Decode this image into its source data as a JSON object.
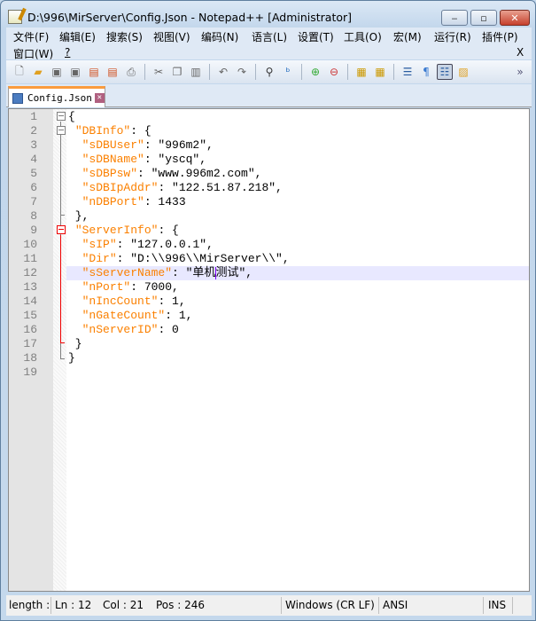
{
  "window": {
    "title": "D:\\996\\MirServer\\Config.Json - Notepad++ [Administrator]",
    "minimize": "‒",
    "maximize": "▫",
    "close": "✕"
  },
  "menu": {
    "items": [
      "文件(F)",
      "编辑(E)",
      "搜索(S)",
      "视图(V)",
      "编码(N)",
      "语言(L)",
      "设置(T)",
      "工具(O)",
      "宏(M)",
      "运行(R)",
      "插件(P)",
      "窗口(W)",
      "?"
    ],
    "close_doc": "X"
  },
  "toolbar": {
    "icons": [
      "new-file-icon",
      "open-file-icon",
      "save-icon",
      "save-all-icon",
      "close-icon",
      "close-all-icon",
      "print-icon",
      "cut-icon",
      "copy-icon",
      "paste-icon",
      "undo-icon",
      "redo-icon",
      "find-icon",
      "replace-icon",
      "zoom-in-icon",
      "zoom-out-icon",
      "sync-vertical-icon",
      "sync-horizontal-icon",
      "word-wrap-icon",
      "show-all-chars-icon",
      "indent-guide-icon",
      "user-language-icon"
    ],
    "overflow": "»"
  },
  "tab": {
    "label": "Config.Json",
    "close": "✕"
  },
  "editor": {
    "current_line": 12,
    "lines": [
      [
        [
          "p",
          "{"
        ]
      ],
      [
        [
          "p",
          " "
        ],
        [
          "k",
          "\"DBInfo\""
        ],
        [
          "p",
          ": {"
        ]
      ],
      [
        [
          "p",
          "  "
        ],
        [
          "k",
          "\"sDBUser\""
        ],
        [
          "p",
          ": \"996m2\","
        ]
      ],
      [
        [
          "p",
          "  "
        ],
        [
          "k",
          "\"sDBName\""
        ],
        [
          "p",
          ": \"yscq\","
        ]
      ],
      [
        [
          "p",
          "  "
        ],
        [
          "k",
          "\"sDBPsw\""
        ],
        [
          "p",
          ": \"www.996m2.com\","
        ]
      ],
      [
        [
          "p",
          "  "
        ],
        [
          "k",
          "\"sDBIpAddr\""
        ],
        [
          "p",
          ": \"122.51.87.218\","
        ]
      ],
      [
        [
          "p",
          "  "
        ],
        [
          "k",
          "\"nDBPort\""
        ],
        [
          "p",
          ": 1433"
        ]
      ],
      [
        [
          "p",
          " },"
        ]
      ],
      [
        [
          "p",
          " "
        ],
        [
          "k",
          "\"ServerInfo\""
        ],
        [
          "p",
          ": {"
        ]
      ],
      [
        [
          "p",
          "  "
        ],
        [
          "k",
          "\"sIP\""
        ],
        [
          "p",
          ": \"127.0.0.1\","
        ]
      ],
      [
        [
          "p",
          "  "
        ],
        [
          "k",
          "\"Dir\""
        ],
        [
          "p",
          ": \"D:\\\\996\\\\MirServer\\\\\","
        ]
      ],
      [
        [
          "p",
          "  "
        ],
        [
          "k",
          "\"sServerName\""
        ],
        [
          "p",
          ": \"单机"
        ],
        [
          "c",
          ""
        ],
        [
          "p",
          "测试\","
        ]
      ],
      [
        [
          "p",
          "  "
        ],
        [
          "k",
          "\"nPort\""
        ],
        [
          "p",
          ": 7000,"
        ]
      ],
      [
        [
          "p",
          "  "
        ],
        [
          "k",
          "\"nIncCount\""
        ],
        [
          "p",
          ": 1,"
        ]
      ],
      [
        [
          "p",
          "  "
        ],
        [
          "k",
          "\"nGateCount\""
        ],
        [
          "p",
          ": 1,"
        ]
      ],
      [
        [
          "p",
          "  "
        ],
        [
          "k",
          "\"nServerID\""
        ],
        [
          "p",
          ": 0"
        ]
      ],
      [
        [
          "p",
          " }"
        ]
      ],
      [
        [
          "p",
          "}"
        ]
      ],
      [
        [
          "p",
          ""
        ]
      ]
    ]
  },
  "status": {
    "length": "length :",
    "ln": "Ln : 12",
    "col": "Col : 21",
    "pos": "Pos : 246",
    "eol": "Windows (CR LF)",
    "encoding": "ANSI",
    "mode": "INS"
  },
  "colors": {
    "key": "#fb8000",
    "current_line": "#e8e8ff",
    "fold_active": "#e00000",
    "tab_accent": "#fa9c3e"
  }
}
